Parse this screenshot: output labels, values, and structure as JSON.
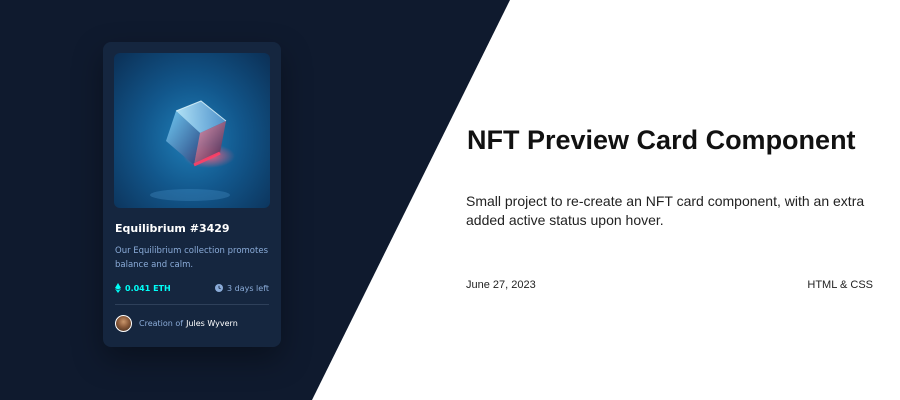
{
  "card": {
    "title": "Equilibrium #3429",
    "description": "Our Equilibrium collection promotes balance and calm.",
    "price": "0.041 ETH",
    "time_left": "3 days left",
    "creator_prefix": "Creation of",
    "creator_name": "Jules Wyvern",
    "icons": {
      "price": "ethereum-icon",
      "time": "clock-icon",
      "image": "equilibrium-cube-image",
      "avatar": "avatar"
    }
  },
  "project": {
    "title": "NFT Preview Card Component",
    "description": "Small project to re-create an NFT card component, with an extra added active status upon hover.",
    "date": "June 27, 2023",
    "tech": "HTML & CSS"
  },
  "colors": {
    "dark_background": "#0f1a2e",
    "card_background": "#15263f",
    "accent_cyan": "#00fff8",
    "soft_blue": "#8bacd9",
    "white": "#ffffff"
  }
}
